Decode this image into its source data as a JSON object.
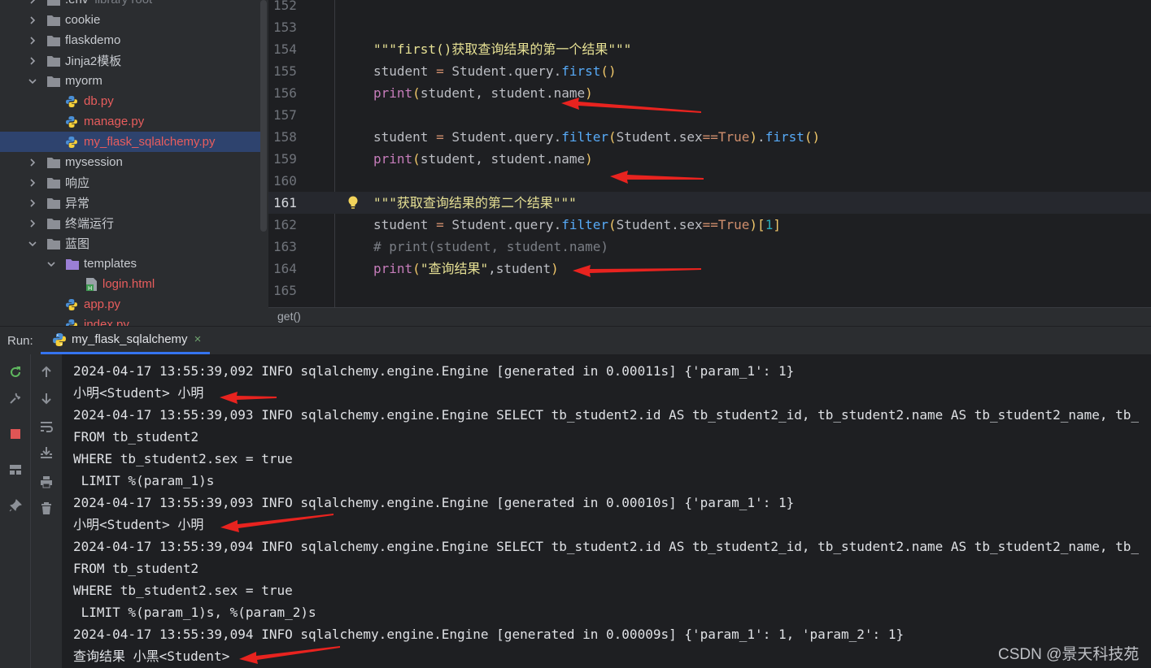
{
  "project_tree": {
    "items": [
      {
        "label": ".env",
        "suffix": "library root",
        "kind": "folder",
        "expanded": false,
        "depth": 0,
        "color": "normal"
      },
      {
        "label": "cookie",
        "kind": "folder",
        "expanded": false,
        "depth": 0,
        "color": "normal"
      },
      {
        "label": "flaskdemo",
        "kind": "folder",
        "expanded": false,
        "depth": 0,
        "color": "normal"
      },
      {
        "label": "Jinja2模板",
        "kind": "folder",
        "expanded": false,
        "depth": 0,
        "color": "normal"
      },
      {
        "label": "myorm",
        "kind": "folder",
        "expanded": true,
        "depth": 0,
        "color": "normal"
      },
      {
        "label": "db.py",
        "kind": "python",
        "depth": 1,
        "color": "red"
      },
      {
        "label": "manage.py",
        "kind": "python",
        "depth": 1,
        "color": "red"
      },
      {
        "label": "my_flask_sqlalchemy.py",
        "kind": "python",
        "depth": 1,
        "color": "red",
        "selected": true
      },
      {
        "label": "mysession",
        "kind": "folder",
        "expanded": false,
        "depth": 0,
        "color": "normal"
      },
      {
        "label": "响应",
        "kind": "folder",
        "expanded": false,
        "depth": 0,
        "color": "normal"
      },
      {
        "label": "异常",
        "kind": "folder",
        "expanded": false,
        "depth": 0,
        "color": "normal"
      },
      {
        "label": "终端运行",
        "kind": "folder",
        "expanded": false,
        "depth": 0,
        "color": "normal"
      },
      {
        "label": "蓝图",
        "kind": "folder",
        "expanded": true,
        "depth": 0,
        "color": "normal"
      },
      {
        "label": "templates",
        "kind": "folder-purple",
        "expanded": true,
        "depth": 1,
        "color": "normal"
      },
      {
        "label": "login.html",
        "kind": "html",
        "depth": 2,
        "color": "red"
      },
      {
        "label": "app.py",
        "kind": "python",
        "depth": 1,
        "color": "red"
      },
      {
        "label": "index.py",
        "kind": "python",
        "depth": 1,
        "color": "red"
      }
    ]
  },
  "editor": {
    "current_line": "161",
    "lines": [
      {
        "n": "152",
        "tokens": []
      },
      {
        "n": "153",
        "tokens": []
      },
      {
        "n": "154",
        "tokens": [
          {
            "t": "\"\"\"first()获取查询结果的第一个结果\"\"\"",
            "c": "str"
          }
        ]
      },
      {
        "n": "155",
        "tokens": [
          {
            "t": "student ",
            "c": "pl"
          },
          {
            "t": "=",
            "c": "op"
          },
          {
            "t": " Student.query.",
            "c": "pl"
          },
          {
            "t": "first",
            "c": "meth"
          },
          {
            "t": "()",
            "c": "paren"
          }
        ]
      },
      {
        "n": "156",
        "tokens": [
          {
            "t": "print",
            "c": "fn"
          },
          {
            "t": "(",
            "c": "paren"
          },
          {
            "t": "student, student.name",
            "c": "pl"
          },
          {
            "t": ")",
            "c": "paren"
          }
        ]
      },
      {
        "n": "157",
        "tokens": []
      },
      {
        "n": "158",
        "tokens": [
          {
            "t": "student ",
            "c": "pl"
          },
          {
            "t": "=",
            "c": "op"
          },
          {
            "t": " Student.query.",
            "c": "pl"
          },
          {
            "t": "filter",
            "c": "meth"
          },
          {
            "t": "(",
            "c": "paren"
          },
          {
            "t": "Student.sex",
            "c": "pl"
          },
          {
            "t": "==",
            "c": "op"
          },
          {
            "t": "True",
            "c": "bool"
          },
          {
            "t": ")",
            "c": "paren"
          },
          {
            "t": ".",
            "c": "pl"
          },
          {
            "t": "first",
            "c": "meth"
          },
          {
            "t": "()",
            "c": "paren"
          }
        ]
      },
      {
        "n": "159",
        "tokens": [
          {
            "t": "print",
            "c": "fn"
          },
          {
            "t": "(",
            "c": "paren"
          },
          {
            "t": "student, student.name",
            "c": "pl"
          },
          {
            "t": ")",
            "c": "paren"
          }
        ]
      },
      {
        "n": "160",
        "tokens": []
      },
      {
        "n": "161",
        "tokens": [
          {
            "t": "\"\"\"获取查询结果的第二个结果\"\"\"",
            "c": "str"
          }
        ]
      },
      {
        "n": "162",
        "tokens": [
          {
            "t": "student ",
            "c": "pl"
          },
          {
            "t": "=",
            "c": "op"
          },
          {
            "t": " Student.query.",
            "c": "pl"
          },
          {
            "t": "filter",
            "c": "meth"
          },
          {
            "t": "(",
            "c": "paren"
          },
          {
            "t": "Student.sex",
            "c": "pl"
          },
          {
            "t": "==",
            "c": "op"
          },
          {
            "t": "True",
            "c": "bool"
          },
          {
            "t": ")",
            "c": "paren"
          },
          {
            "t": "[",
            "c": "paren"
          },
          {
            "t": "1",
            "c": "num"
          },
          {
            "t": "]",
            "c": "paren"
          }
        ]
      },
      {
        "n": "163",
        "tokens": [
          {
            "t": "# print(student, student.name)",
            "c": "cm"
          }
        ]
      },
      {
        "n": "164",
        "tokens": [
          {
            "t": "print",
            "c": "fn"
          },
          {
            "t": "(",
            "c": "paren"
          },
          {
            "t": "\"查询结果\"",
            "c": "str"
          },
          {
            "t": ",student",
            "c": "pl"
          },
          {
            "t": ")",
            "c": "paren"
          }
        ]
      },
      {
        "n": "165",
        "tokens": []
      }
    ]
  },
  "breadcrumb": {
    "label": "get()"
  },
  "run_panel": {
    "label": "Run:",
    "tab_label": "my_flask_sqlalchemy",
    "tab_close": "×",
    "output": [
      "2024-04-17 13:55:39,092 INFO sqlalchemy.engine.Engine [generated in 0.00011s] {'param_1': 1}",
      "小明<Student> 小明",
      "2024-04-17 13:55:39,093 INFO sqlalchemy.engine.Engine SELECT tb_student2.id AS tb_student2_id, tb_student2.name AS tb_student2_name, tb_",
      "FROM tb_student2",
      "WHERE tb_student2.sex = true",
      " LIMIT %(param_1)s",
      "2024-04-17 13:55:39,093 INFO sqlalchemy.engine.Engine [generated in 0.00010s] {'param_1': 1}",
      "小明<Student> 小明",
      "2024-04-17 13:55:39,094 INFO sqlalchemy.engine.Engine SELECT tb_student2.id AS tb_student2_id, tb_student2.name AS tb_student2_name, tb_",
      "FROM tb_student2",
      "WHERE tb_student2.sex = true",
      " LIMIT %(param_1)s, %(param_2)s",
      "2024-04-17 13:55:39,094 INFO sqlalchemy.engine.Engine [generated in 0.00009s] {'param_1': 1, 'param_2': 1}",
      "查询结果 小黑<Student>"
    ]
  },
  "watermark": "CSDN @景天科技苑",
  "colors": {
    "accent": "#3574f0",
    "annotation_arrow": "#e8231f",
    "selection": "#2e436e"
  }
}
